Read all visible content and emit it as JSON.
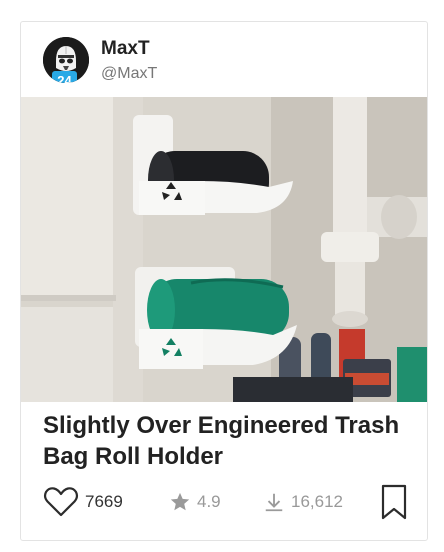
{
  "author": {
    "name": "MaxT",
    "handle": "@MaxT",
    "level": "24",
    "level_badge_color": "#29a9e6"
  },
  "model": {
    "title": "Slightly Over Engineered Trash Bag Roll Holder",
    "likes": "7669",
    "rating": "4.9",
    "downloads": "16,612"
  },
  "icons": {
    "like": "heart-outline-icon",
    "rating": "star-icon",
    "downloads": "download-arrow-icon",
    "bookmark": "bookmark-outline-icon"
  }
}
